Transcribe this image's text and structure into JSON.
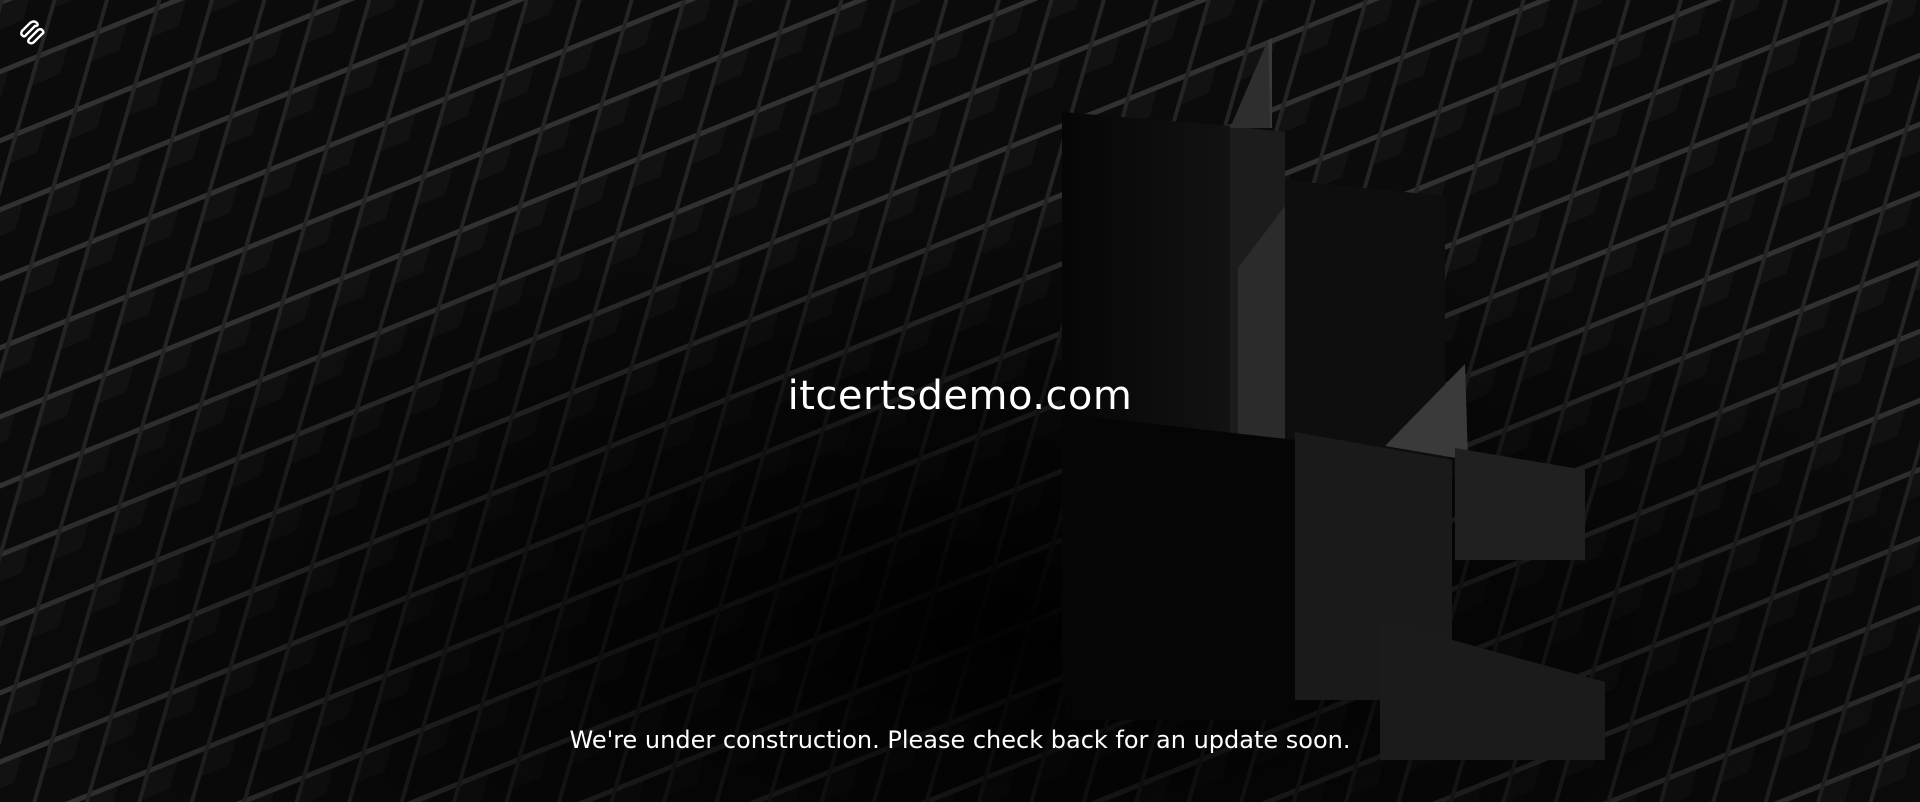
{
  "logo": {
    "icon": "squarespace-logo-icon"
  },
  "site": {
    "title": "itcertsdemo.com"
  },
  "notice": {
    "message": "We're under construction. Please check back for an update soon."
  },
  "colors": {
    "text": "#ffffff",
    "background": "#0a0a0a",
    "grid": "#3a3a3a"
  }
}
